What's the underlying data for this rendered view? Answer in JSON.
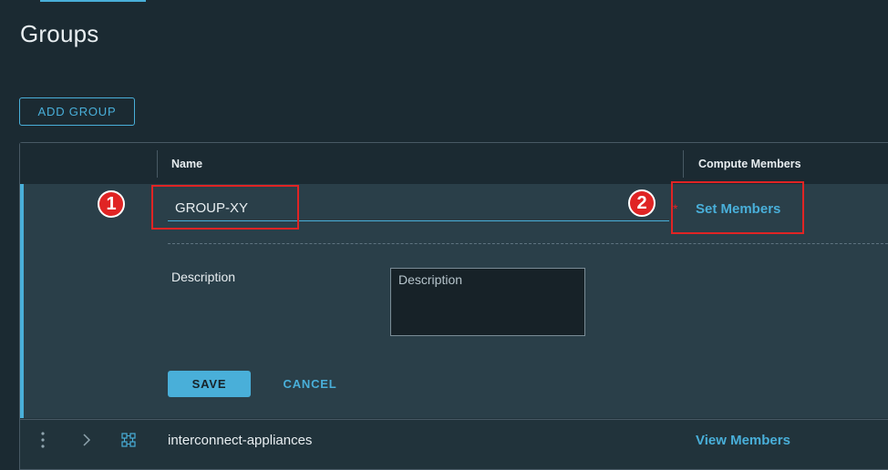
{
  "page": {
    "title": "Groups"
  },
  "toolbar": {
    "add_group_label": "ADD GROUP"
  },
  "table": {
    "columns": [
      "Name",
      "Compute Members"
    ],
    "edit_row": {
      "name_value": "GROUP-XY",
      "required_mark": "*",
      "set_members_label": "Set Members",
      "description_label": "Description",
      "description_placeholder": "Description",
      "save_label": "SAVE",
      "cancel_label": "CANCEL"
    },
    "rows": [
      {
        "name": "interconnect-appliances",
        "members_link": "View Members"
      }
    ]
  },
  "annotations": {
    "badge_1": "1",
    "badge_2": "2"
  },
  "colors": {
    "accent": "#49afd9",
    "highlight": "#e02424",
    "background": "#1b2a32"
  }
}
